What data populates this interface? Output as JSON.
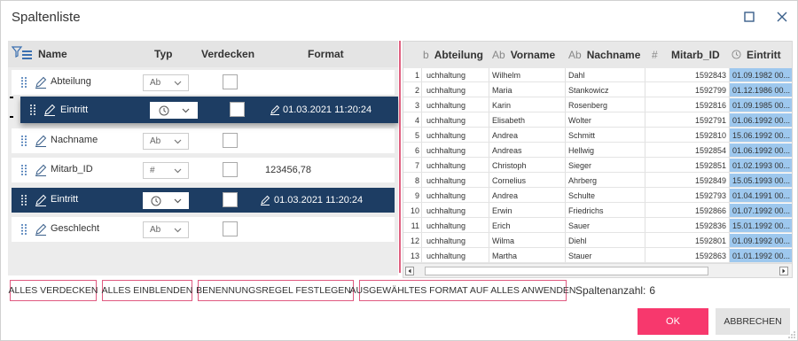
{
  "window": {
    "title": "Spaltenliste"
  },
  "column_list": {
    "headers": {
      "name": "Name",
      "typ": "Typ",
      "verdecken": "Verdecken",
      "format": "Format"
    },
    "rows": [
      {
        "name": "Abteilung",
        "type": "Ab",
        "format": "",
        "selected": false
      },
      {
        "name": "Nachname",
        "type": "Ab",
        "format": "",
        "selected": false
      },
      {
        "name": "Mitarb_ID",
        "type": "#",
        "format": "123456,78",
        "selected": false
      },
      {
        "name": "Eintritt",
        "type": "clock",
        "format": "01.03.2021 11:20:24",
        "selected": true
      },
      {
        "name": "Geschlecht",
        "type": "Ab",
        "format": "",
        "selected": false
      }
    ],
    "dragged_row": {
      "name": "Eintritt",
      "type": "clock",
      "format": "01.03.2021 11:20:24"
    }
  },
  "preview_grid": {
    "columns": [
      {
        "icon": "b",
        "label": "Abteilung"
      },
      {
        "icon": "Ab",
        "label": "Vorname"
      },
      {
        "icon": "Ab",
        "label": "Nachname"
      },
      {
        "icon": "#",
        "label": ""
      },
      {
        "icon": "",
        "label": "Mitarb_ID"
      },
      {
        "icon": "clock",
        "label": "Eintritt"
      }
    ],
    "rows": [
      [
        "1",
        "uchhaltung",
        "Wilhelm",
        "Dahl",
        "1592843",
        "01.09.1982 00..."
      ],
      [
        "2",
        "uchhaltung",
        "Maria",
        "Stankowicz",
        "1592799",
        "01.12.1986 00..."
      ],
      [
        "3",
        "uchhaltung",
        "Karin",
        "Rosenberg",
        "1592816",
        "01.09.1985 00..."
      ],
      [
        "4",
        "uchhaltung",
        "Elisabeth",
        "Wolter",
        "1592791",
        "01.06.1992 00..."
      ],
      [
        "5",
        "uchhaltung",
        "Andrea",
        "Schmitt",
        "1592810",
        "15.06.1992 00..."
      ],
      [
        "6",
        "uchhaltung",
        "Andreas",
        "Hellwig",
        "1592854",
        "01.06.1992 00..."
      ],
      [
        "7",
        "uchhaltung",
        "Christoph",
        "Sieger",
        "1592851",
        "01.02.1993 00..."
      ],
      [
        "8",
        "uchhaltung",
        "Cornelius",
        "Ahrberg",
        "1592849",
        "15.05.1993 00..."
      ],
      [
        "9",
        "uchhaltung",
        "Andrea",
        "Schulte",
        "1592793",
        "01.04.1991 00..."
      ],
      [
        "10",
        "uchhaltung",
        "Erwin",
        "Friedrichs",
        "1592866",
        "01.07.1992 00..."
      ],
      [
        "11",
        "uchhaltung",
        "Erich",
        "Sauer",
        "1592836",
        "15.01.1992 00..."
      ],
      [
        "12",
        "uchhaltung",
        "Wilma",
        "Diehl",
        "1592801",
        "01.09.1992 00..."
      ],
      [
        "13",
        "uchhaltung",
        "Martha",
        "Stauer",
        "1592863",
        "01.01.1992 00..."
      ]
    ]
  },
  "actions": {
    "hide_all": "ALLES VERDECKEN",
    "show_all": "ALLES EINBLENDEN",
    "naming_rule": "BENENNUNGSREGEL FESTLEGEN",
    "apply_format": "AUSGEWÄHLTES FORMAT AUF ALLES ANWENDEN",
    "column_count_label": "Spaltenanzahl:",
    "column_count": "6",
    "ok": "OK",
    "cancel": "ABBRECHEN"
  },
  "colors": {
    "selection": "#1d3d63",
    "accent": "#f7386d",
    "date_highlight": "#9ec8ee"
  }
}
